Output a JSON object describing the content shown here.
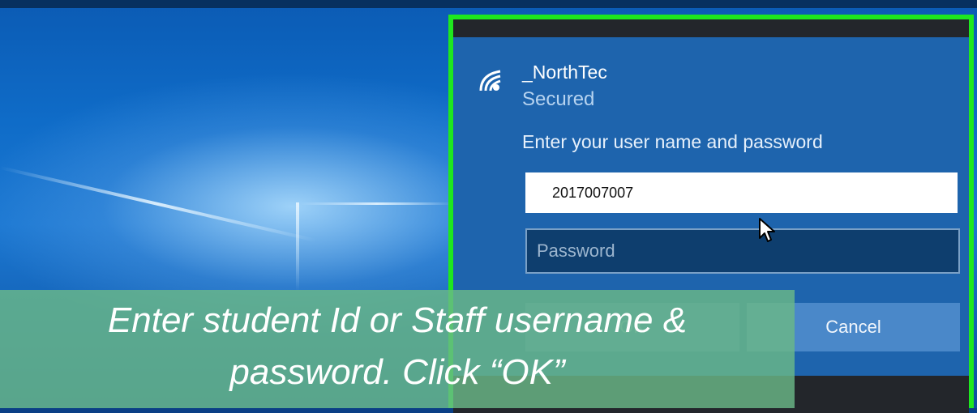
{
  "network": {
    "name": "_NorthTec",
    "status": "Secured",
    "prompt": "Enter your user name and password"
  },
  "form": {
    "username_value": "2017007007",
    "password_placeholder": "Password",
    "ok_label": "OK",
    "cancel_label": "Cancel"
  },
  "caption": {
    "line1": "Enter student Id or Staff username &",
    "line2": "password. Click “OK”"
  },
  "colors": {
    "highlight": "#1ee81e",
    "panel": "#1e64ad",
    "caption_bg": "#6ab888"
  },
  "icons": [
    "wifi-icon",
    "mouse-cursor-icon"
  ]
}
